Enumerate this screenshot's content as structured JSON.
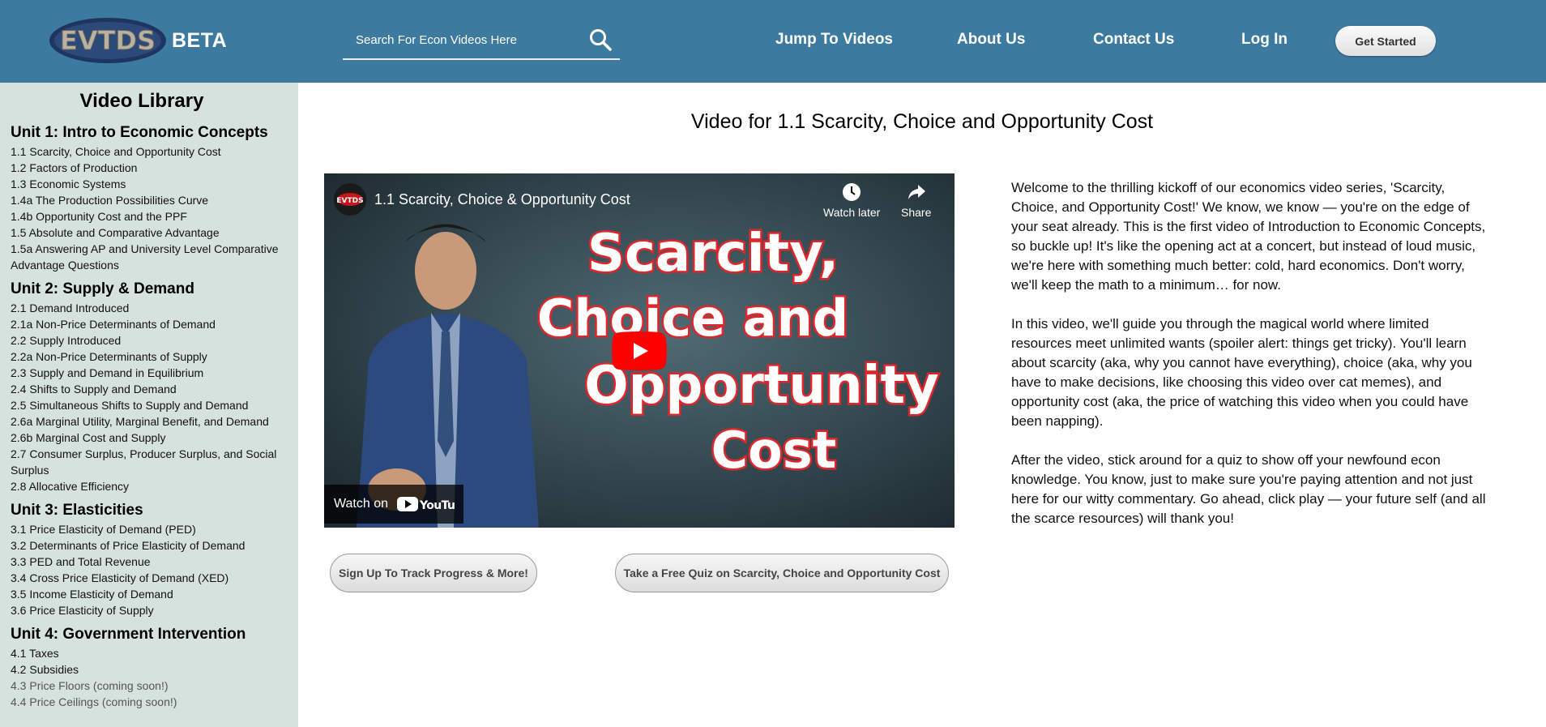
{
  "header": {
    "logo_text": "EVTDS",
    "beta_label": "BETA",
    "search_placeholder": "Search For Econ Videos Here",
    "nav": [
      {
        "label": "Jump To Videos"
      },
      {
        "label": "About Us"
      },
      {
        "label": "Contact Us"
      },
      {
        "label": "Log In"
      }
    ],
    "cta_label": "Get Started",
    "icons": {
      "search": "search-icon"
    },
    "colors": {
      "header_bg": "#3d7aa0",
      "sidebar_bg": "#d5e2de"
    }
  },
  "sidebar": {
    "title": "Video Library",
    "units": [
      {
        "heading": "Unit 1: Intro to Economic Concepts",
        "lessons": [
          "1.1 Scarcity, Choice and Opportunity Cost",
          "1.2 Factors of Production",
          "1.3 Economic Systems",
          "1.4a The Production Possibilities Curve",
          "1.4b Opportunity Cost and the PPF",
          "1.5 Absolute and Comparative Advantage",
          "1.5a Answering AP and University Level Comparative Advantage Questions"
        ]
      },
      {
        "heading": "Unit 2: Supply & Demand",
        "lessons": [
          "2.1 Demand Introduced",
          "2.1a Non-Price Determinants of Demand",
          "2.2 Supply Introduced",
          "2.2a Non-Price Determinants of Supply",
          "2.3 Supply and Demand in Equilibrium",
          "2.4 Shifts to Supply and Demand",
          "2.5 Simultaneous Shifts to Supply and Demand",
          "2.6a Marginal Utility, Marginal Benefit, and Demand",
          "2.6b Marginal Cost and Supply",
          "2.7 Consumer Surplus, Producer Surplus, and Social Surplus",
          "2.8 Allocative Efficiency"
        ]
      },
      {
        "heading": "Unit 3: Elasticities",
        "lessons": [
          "3.1 Price Elasticity of Demand (PED)",
          "3.2 Determinants of Price Elasticity of Demand",
          "3.3 PED and Total Revenue",
          "3.4 Cross Price Elasticity of Demand (XED)",
          "3.5 Income Elasticity of Demand",
          "3.6 Price Elasticity of Supply"
        ]
      },
      {
        "heading": "Unit 4: Government Intervention",
        "lessons": [
          "4.1 Taxes",
          "4.2 Subsidies",
          "4.3 Price Floors (coming soon!)",
          "4.4 Price Ceilings (coming soon!)"
        ]
      }
    ]
  },
  "main": {
    "title": "Video for 1.1 Scarcity, Choice and Opportunity Cost",
    "video": {
      "channel_logo": "EVTDS",
      "title": "1.1 Scarcity, Choice & Opportunity Cost",
      "watch_later": "Watch later",
      "share": "Share",
      "watch_on": "Watch on",
      "youtube": "YouTube",
      "thumbnail_text": [
        "Scarcity,",
        "Choice and",
        "Opportunity",
        "Cost"
      ]
    },
    "description": [
      "Welcome to the thrilling kickoff of our economics video series, 'Scarcity, Choice, and Opportunity Cost!' We know, we know — you're on the edge of your seat already. This is the first video of Introduction to Economic Concepts, so buckle up! It's like the opening act at a concert, but instead of loud music, we're here with something much better: cold, hard economics. Don't worry, we'll keep the math to a minimum… for now.",
      "In this video, we'll guide you through the magical world where limited resources meet unlimited wants (spoiler alert: things get tricky). You'll learn about scarcity (aka, why you cannot have everything), choice (aka, why you have to make decisions, like choosing this video over cat memes), and opportunity cost (aka, the price of watching this video when you could have been napping).",
      "After the video, stick around for a quiz to show off your newfound econ knowledge. You know, just to make sure you're paying attention and not just here for our witty commentary. Go ahead, click play — your future self (and all the scarce resources) will thank you!"
    ],
    "signup_label": "Sign Up To Track Progress & More!",
    "quiz_label": "Take a Free Quiz on Scarcity, Choice and Opportunity Cost"
  }
}
